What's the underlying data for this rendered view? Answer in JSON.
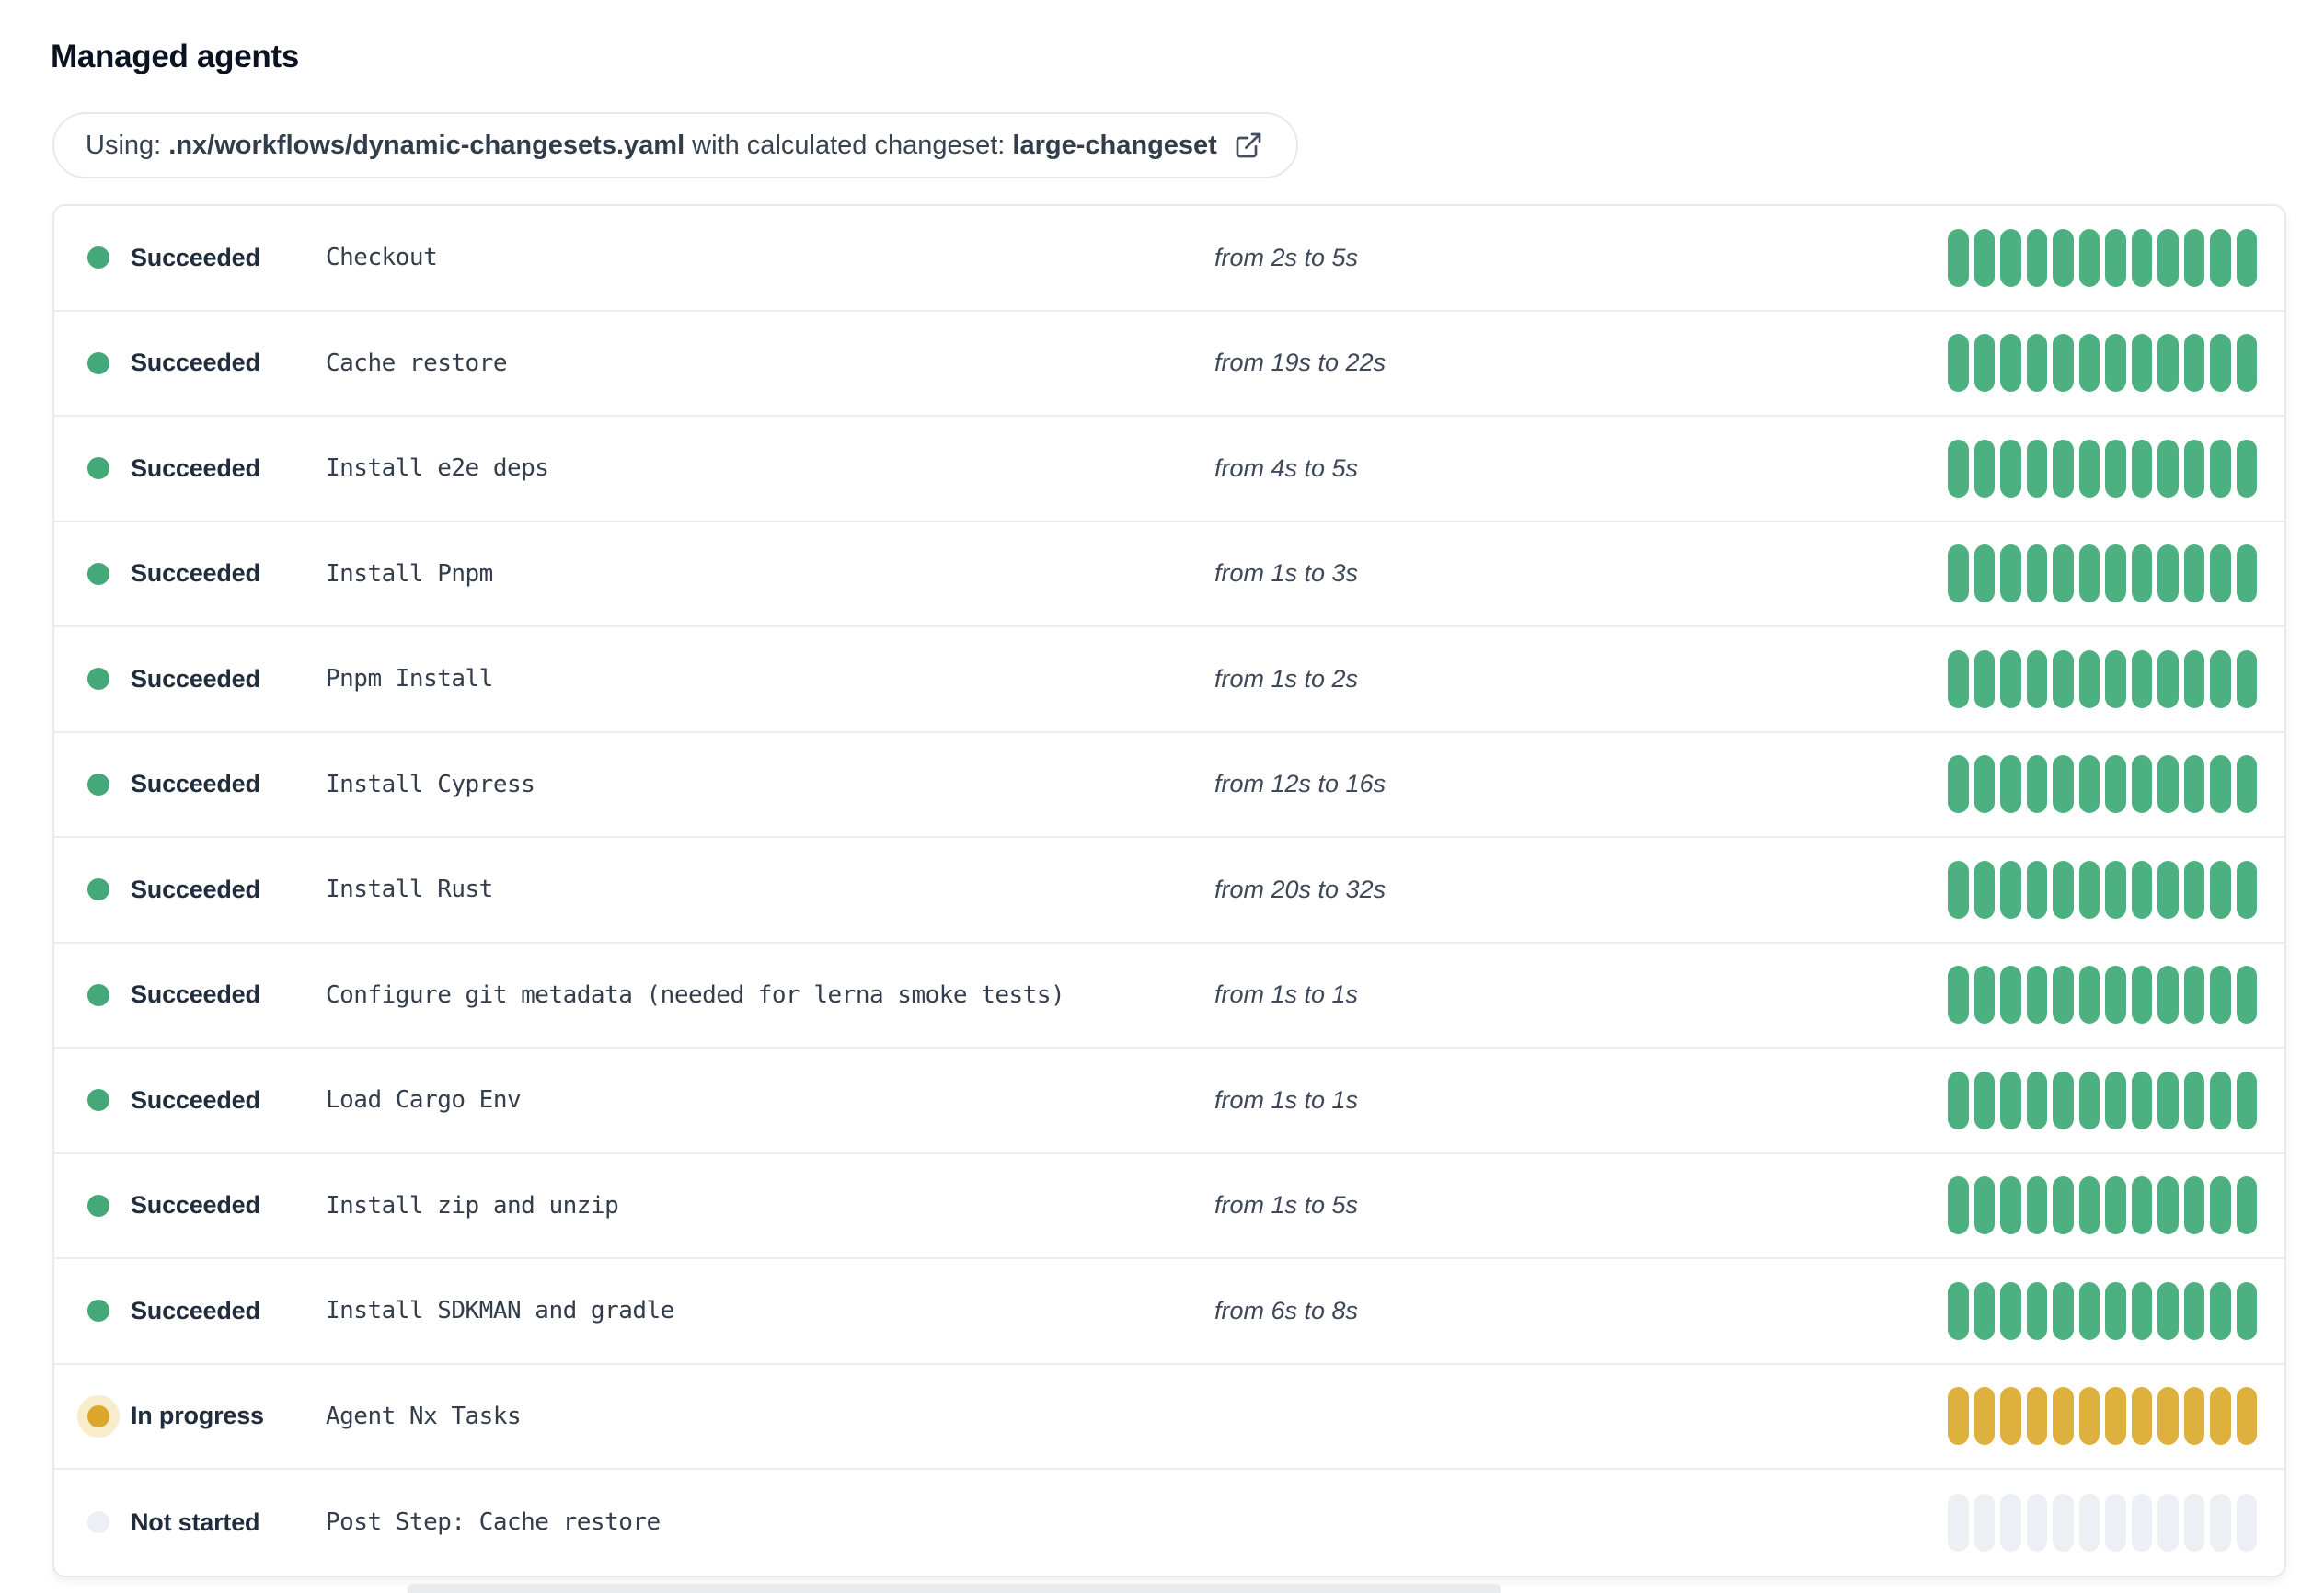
{
  "page": {
    "title": "Managed agents"
  },
  "banner": {
    "prefix": "Using: ",
    "workflow_path": ".nx/workflows/dynamic-changesets.yaml",
    "middle": " with calculated changeset: ",
    "changeset": "large-changeset",
    "icon": "external-link-icon"
  },
  "agents": {
    "segments_per_bar": 12,
    "rows": [
      {
        "status": "Succeeded",
        "state": "succeeded",
        "step": "Checkout",
        "duration": "from 2s to 5s"
      },
      {
        "status": "Succeeded",
        "state": "succeeded",
        "step": "Cache restore",
        "duration": "from 19s to 22s"
      },
      {
        "status": "Succeeded",
        "state": "succeeded",
        "step": "Install e2e deps",
        "duration": "from 4s to 5s"
      },
      {
        "status": "Succeeded",
        "state": "succeeded",
        "step": "Install Pnpm",
        "duration": "from 1s to 3s"
      },
      {
        "status": "Succeeded",
        "state": "succeeded",
        "step": "Pnpm Install",
        "duration": "from 1s to 2s"
      },
      {
        "status": "Succeeded",
        "state": "succeeded",
        "step": "Install Cypress",
        "duration": "from 12s to 16s"
      },
      {
        "status": "Succeeded",
        "state": "succeeded",
        "step": "Install Rust",
        "duration": "from 20s to 32s"
      },
      {
        "status": "Succeeded",
        "state": "succeeded",
        "step": "Configure git metadata (needed for lerna smoke tests)",
        "duration": "from 1s to 1s"
      },
      {
        "status": "Succeeded",
        "state": "succeeded",
        "step": "Load Cargo Env",
        "duration": "from 1s to 1s"
      },
      {
        "status": "Succeeded",
        "state": "succeeded",
        "step": "Install zip and unzip",
        "duration": "from 1s to 5s"
      },
      {
        "status": "Succeeded",
        "state": "succeeded",
        "step": "Install SDKMAN and gradle",
        "duration": "from 6s to 8s"
      },
      {
        "status": "In progress",
        "state": "in_progress",
        "step": "Agent Nx Tasks",
        "duration": ""
      },
      {
        "status": "Not started",
        "state": "not_started",
        "step": "Post Step: Cache restore",
        "duration": ""
      }
    ]
  },
  "colors": {
    "succeeded": "#4CB081",
    "succeeded_dot": "#45A878",
    "in_progress": "#DEB03D",
    "in_progress_dot": "#DCA72A",
    "in_progress_halo": "#F7EDCB",
    "not_started": "#ECF0F5"
  }
}
